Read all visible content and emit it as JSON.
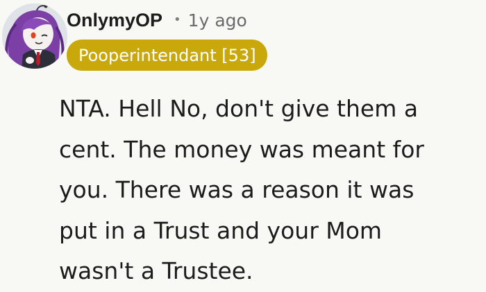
{
  "comment": {
    "author": "OnlymyOP",
    "separator": "•",
    "timestamp": "1y ago",
    "flair": "Pooperintendant [53]",
    "flair_color": "#c9a80c",
    "avatar_icon": "anime-avatar-purple-hair",
    "body_lines": [
      "NTA. Hell No, don't give them a",
      "cent. The money was meant for",
      "you. There was a reason it was",
      "put in a Trust and your Mom",
      "wasn't a Trustee."
    ]
  }
}
